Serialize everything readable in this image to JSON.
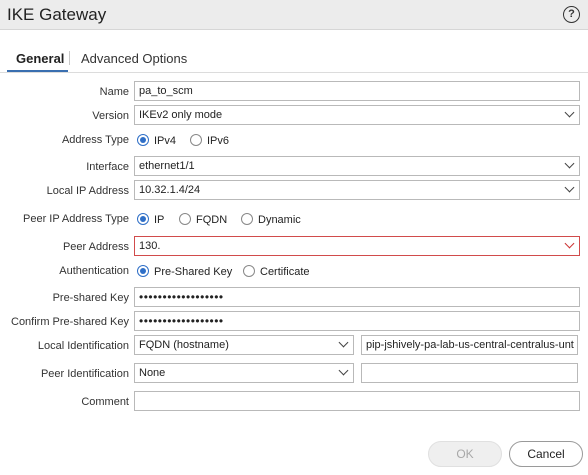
{
  "window": {
    "title": "IKE Gateway",
    "help_icon": "?"
  },
  "tabs": [
    {
      "label": "General",
      "selected": true
    },
    {
      "label": "Advanced Options",
      "selected": false
    }
  ],
  "form": {
    "name": {
      "label": "Name",
      "value": "pa_to_scm"
    },
    "version": {
      "label": "Version",
      "value": "IKEv2 only mode"
    },
    "address_type": {
      "label": "Address Type",
      "options": [
        {
          "label": "IPv4",
          "selected": true
        },
        {
          "label": "IPv6",
          "selected": false
        }
      ]
    },
    "interface": {
      "label": "Interface",
      "value": "ethernet1/1"
    },
    "local_ip": {
      "label": "Local IP Address",
      "value": "10.32.1.4/24"
    },
    "peer_ip_type": {
      "label": "Peer IP Address Type",
      "options": [
        {
          "label": "IP",
          "selected": true
        },
        {
          "label": "FQDN",
          "selected": false
        },
        {
          "label": "Dynamic",
          "selected": false
        }
      ]
    },
    "peer_address": {
      "label": "Peer Address",
      "value": "130."
    },
    "authentication": {
      "label": "Authentication",
      "options": [
        {
          "label": "Pre-Shared Key",
          "selected": true
        },
        {
          "label": "Certificate",
          "selected": false
        }
      ]
    },
    "psk": {
      "label": "Pre-shared Key",
      "value": "••••••••••••••••••"
    },
    "confirm_psk": {
      "label": "Confirm Pre-shared Key",
      "value": "••••••••••••••••••"
    },
    "local_id": {
      "label": "Local Identification",
      "type": "FQDN (hostname)",
      "value": "pip-jshively-pa-lab-us-central-centralus-unt"
    },
    "peer_id": {
      "label": "Peer Identification",
      "type": "None",
      "value": ""
    },
    "comment": {
      "label": "Comment",
      "value": ""
    }
  },
  "buttons": {
    "ok": "OK",
    "cancel": "Cancel"
  },
  "colors": {
    "accent": "#2f6fc7",
    "invalid": "#d14b4b",
    "tab_underline": "#3a6fb0"
  }
}
